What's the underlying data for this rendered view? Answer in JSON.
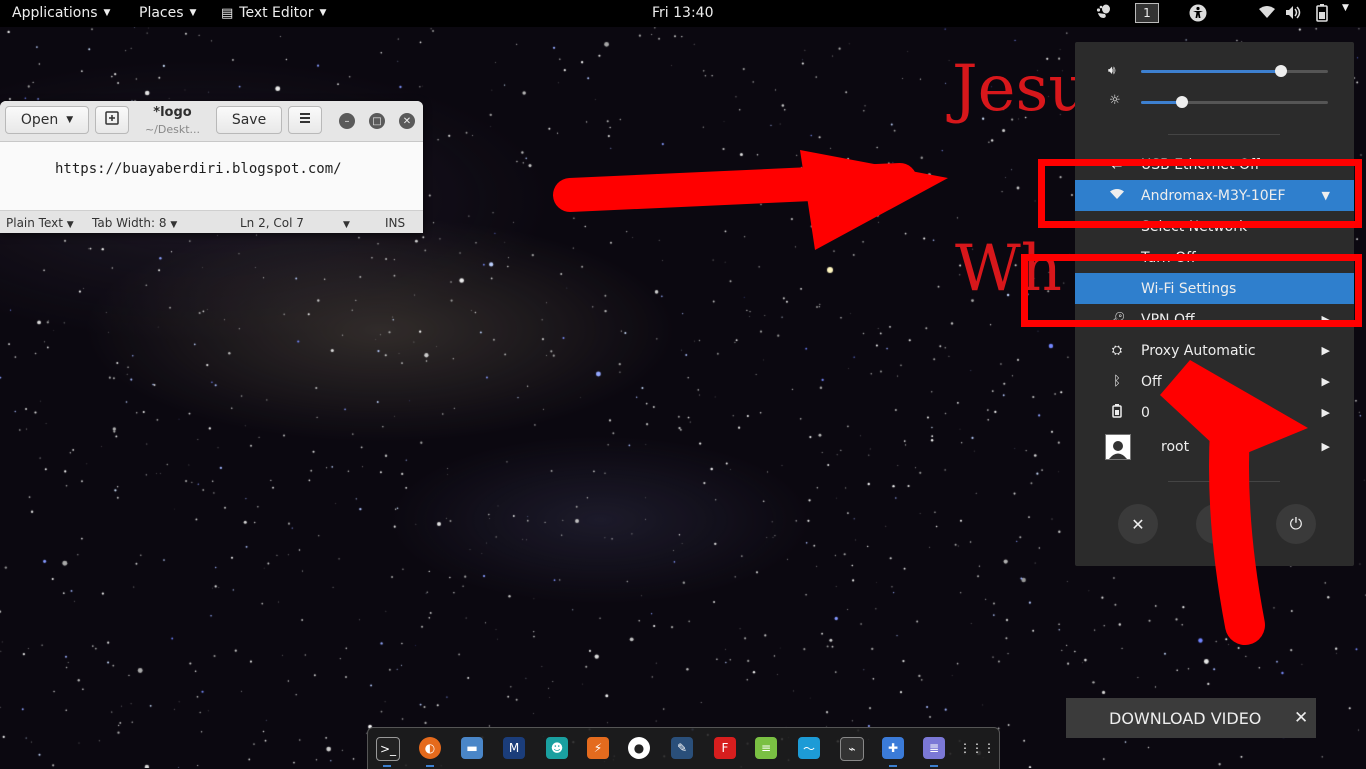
{
  "topbar": {
    "applications": "Applications",
    "places": "Places",
    "text_editor": "Text Editor",
    "clock": "Fri 13:40",
    "workspace": "1",
    "icons": [
      "gnome-icon",
      "accessibility-icon",
      "wifi-icon",
      "volume-icon",
      "battery-icon"
    ]
  },
  "wallpaper_text": {
    "line1": "Jesu",
    "line2": "Wh"
  },
  "editor": {
    "open_label": "Open",
    "title": "*logo",
    "subtitle": "~/Deskt...",
    "save_label": "Save",
    "content": "https://buayaberdiri.blogspot.com/",
    "status": {
      "language": "Plain Text",
      "tab_width": "Tab Width: 8",
      "position": "Ln 2, Col 7",
      "mode": "INS"
    }
  },
  "system_menu": {
    "volume_level": 0.75,
    "brightness_level": 0.22,
    "items": {
      "wired": "USB Ethernet Off",
      "wifi": "Andromax-M3Y-10EF",
      "select_network": "Select Network",
      "turn_off": "Turn Off",
      "wifi_settings": "Wi-Fi Settings",
      "vpn": "VPN Off",
      "proxy": "Proxy Automatic",
      "bluetooth": "Off",
      "battery": "0",
      "user": "root"
    }
  },
  "download_bar": {
    "label": "DOWNLOAD VIDEO",
    "close": "✕"
  },
  "dock": {
    "apps": [
      "terminal",
      "firefox",
      "files",
      "metasploit",
      "armitage",
      "burpsuite",
      "maltego",
      "beef",
      "faraday",
      "leafpad",
      "system-monitor",
      "gnome-system-monitor",
      "network",
      "text-editor",
      "show-apps"
    ]
  },
  "colors": {
    "accent": "#2f7fcd",
    "annotation": "#ff0000",
    "wallpaper_text": "#d8171b"
  }
}
